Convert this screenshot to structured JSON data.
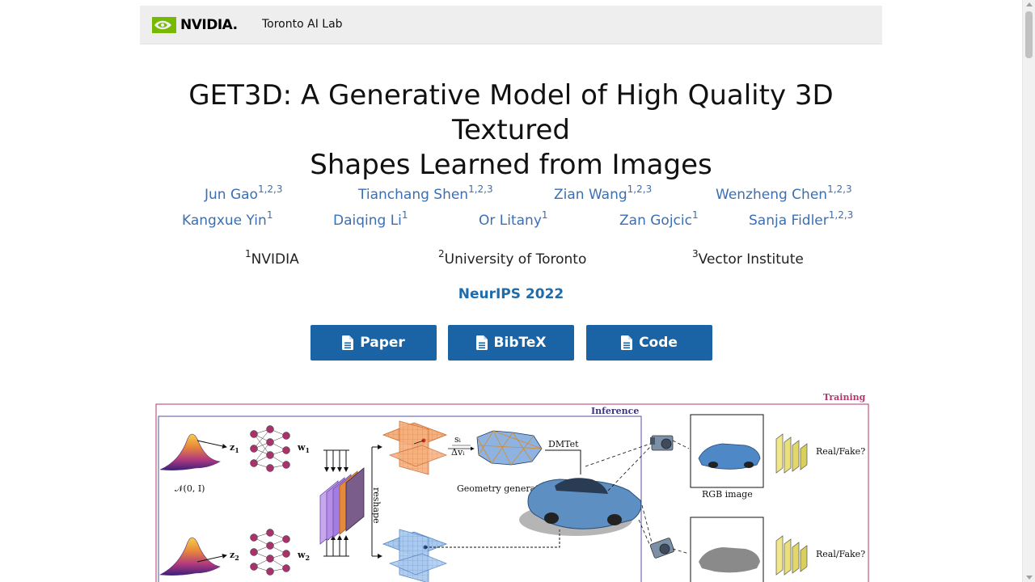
{
  "header": {
    "logo_text": "NVIDIA.",
    "lab_name": "Toronto AI Lab"
  },
  "title": {
    "line1": "GET3D: A Generative Model of High Quality 3D Textured",
    "line2": "Shapes Learned from Images"
  },
  "authors": [
    {
      "name": "Jun Gao",
      "sup": "1,2,3"
    },
    {
      "name": "Tianchang Shen",
      "sup": "1,2,3"
    },
    {
      "name": "Zian Wang",
      "sup": "1,2,3"
    },
    {
      "name": "Wenzheng Chen",
      "sup": "1,2,3"
    },
    {
      "name": "Kangxue Yin",
      "sup": "1"
    },
    {
      "name": "Daiqing Li",
      "sup": "1"
    },
    {
      "name": "Or Litany",
      "sup": "1"
    },
    {
      "name": "Zan Gojcic",
      "sup": "1"
    },
    {
      "name": "Sanja Fidler",
      "sup": "1,2,3"
    }
  ],
  "affiliations": [
    {
      "sup": "1",
      "name": "NVIDIA"
    },
    {
      "sup": "2",
      "name": "University of Toronto"
    },
    {
      "sup": "3",
      "name": "Vector Institute"
    }
  ],
  "venue": "NeurIPS 2022",
  "buttons": {
    "paper": "Paper",
    "bibtex": "BibTeX",
    "code": "Code"
  },
  "figure": {
    "training_label": "Training",
    "inference_label": "Inference",
    "z1": "z",
    "z1_sub": "1",
    "z2": "z",
    "z2_sub": "2",
    "w1": "w",
    "w1_sub": "1",
    "w2": "w",
    "w2_sub": "2",
    "normal_dist": "𝒩(0, I)",
    "reshape": "reshape",
    "geometry_generator": "Geometry generator",
    "s_i": "sᵢ",
    "delta_v": "Δvᵢ",
    "dmtet": "DMTet",
    "rgb_image": "RGB image",
    "real_fake_1": "Real/Fake?",
    "real_fake_2": "Real/Fake?"
  },
  "colors": {
    "accent_blue": "#1a64a6",
    "author_link": "#3b6fb3",
    "nvidia_green": "#76b900",
    "training_border": "#b03a6e",
    "inference_border": "#5a4fa0"
  }
}
